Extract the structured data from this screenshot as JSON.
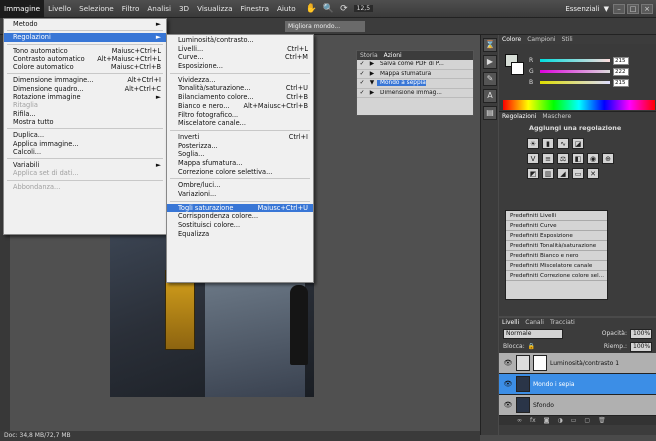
{
  "menubar": {
    "items": [
      "Immagine",
      "Livello",
      "Selezione",
      "Filtro",
      "Analisi",
      "3D",
      "Visualizza",
      "Finestra",
      "Aiuto"
    ],
    "active": 0,
    "workspace": "Essenziali",
    "zoom_label": "12,5",
    "tab_label": "Migliora mondo..."
  },
  "main_menu": {
    "items": [
      {
        "label": "Metodo",
        "shortcut": "►"
      },
      {
        "sep": true
      },
      {
        "label": "Regolazioni",
        "shortcut": "►",
        "hl": true
      },
      {
        "sep": true
      },
      {
        "label": "Tono automatico",
        "shortcut": "Maiusc+Ctrl+L"
      },
      {
        "label": "Contrasto automatico",
        "shortcut": "Alt+Maiusc+Ctrl+L"
      },
      {
        "label": "Colore automatico",
        "shortcut": "Maiusc+Ctrl+B"
      },
      {
        "sep": true
      },
      {
        "label": "Dimensione immagine...",
        "shortcut": "Alt+Ctrl+I"
      },
      {
        "label": "Dimensione quadro...",
        "shortcut": "Alt+Ctrl+C"
      },
      {
        "label": "Rotazione immagine",
        "shortcut": "►"
      },
      {
        "label": "Ritaglia",
        "shortcut": "",
        "dis": true
      },
      {
        "label": "Rifila...",
        "shortcut": ""
      },
      {
        "label": "Mostra tutto",
        "shortcut": ""
      },
      {
        "sep": true
      },
      {
        "label": "Duplica...",
        "shortcut": ""
      },
      {
        "label": "Applica immagine...",
        "shortcut": ""
      },
      {
        "label": "Calcoli...",
        "shortcut": ""
      },
      {
        "sep": true
      },
      {
        "label": "Variabili",
        "shortcut": "►"
      },
      {
        "label": "Applica set di dati...",
        "shortcut": "",
        "dis": true
      },
      {
        "sep": true
      },
      {
        "label": "Abbondanza...",
        "shortcut": "",
        "dis": true
      }
    ]
  },
  "sub_menu": {
    "items": [
      {
        "label": "Luminosità/contrasto...",
        "shortcut": ""
      },
      {
        "label": "Livelli...",
        "shortcut": "Ctrl+L"
      },
      {
        "label": "Curve...",
        "shortcut": "Ctrl+M"
      },
      {
        "label": "Esposizione...",
        "shortcut": ""
      },
      {
        "sep": true
      },
      {
        "label": "Vividezza...",
        "shortcut": ""
      },
      {
        "label": "Tonalità/saturazione...",
        "shortcut": "Ctrl+U"
      },
      {
        "label": "Bilanciamento colore...",
        "shortcut": "Ctrl+B"
      },
      {
        "label": "Bianco e nero...",
        "shortcut": "Alt+Maiusc+Ctrl+B"
      },
      {
        "label": "Filtro fotografico...",
        "shortcut": ""
      },
      {
        "label": "Miscelatore canale...",
        "shortcut": ""
      },
      {
        "sep": true
      },
      {
        "label": "Inverti",
        "shortcut": "Ctrl+I"
      },
      {
        "label": "Posterizza...",
        "shortcut": ""
      },
      {
        "label": "Soglia...",
        "shortcut": ""
      },
      {
        "label": "Mappa sfumatura...",
        "shortcut": ""
      },
      {
        "label": "Correzione colore selettiva...",
        "shortcut": ""
      },
      {
        "sep": true
      },
      {
        "label": "Ombre/luci...",
        "shortcut": ""
      },
      {
        "label": "Variazioni...",
        "shortcut": ""
      },
      {
        "sep": true
      },
      {
        "label": "Togli saturazione",
        "shortcut": "Maiusc+Ctrl+U",
        "hl": true
      },
      {
        "label": "Corrispondenza colore...",
        "shortcut": ""
      },
      {
        "label": "Sostituisci colore...",
        "shortcut": ""
      },
      {
        "label": "Equalizza",
        "shortcut": ""
      }
    ]
  },
  "actions_panel": {
    "tabs": [
      "Storia",
      "Azioni"
    ],
    "rows": [
      {
        "label": "Salva come PDF di P...",
        "hl": false
      },
      {
        "label": "Mappa sfumatura",
        "hl": false
      },
      {
        "label": "Mondo a seppia",
        "hl": true
      },
      {
        "label": "Dimensione immag...",
        "hl": false
      }
    ]
  },
  "color_panel": {
    "tabs": [
      "Colore",
      "Campioni",
      "Stili"
    ],
    "channels": [
      {
        "name": "R",
        "value": "215"
      },
      {
        "name": "G",
        "value": "222"
      },
      {
        "name": "B",
        "value": "215"
      }
    ]
  },
  "adjust_panel": {
    "tabs": [
      "Regolazioni",
      "Maschere"
    ],
    "title": "Aggiungi una regolazione",
    "presets": [
      "Predefiniti Livelli",
      "Predefiniti Curve",
      "Predefiniti Esposizione",
      "Predefiniti Tonalità/saturazione",
      "Predefiniti Bianco e nero",
      "Predefiniti Miscelatore canale",
      "Predefiniti Correzione colore sel..."
    ]
  },
  "layers_panel": {
    "tabs": [
      "Livelli",
      "Canali",
      "Tracciati"
    ],
    "blend_mode": "Normale",
    "opacity_label": "Opacità:",
    "opacity": "100%",
    "lock_label": "Blocca:",
    "fill_label": "Riemp.:",
    "fill": "100%",
    "layers": [
      {
        "name": "Luminosità/contrasto 1",
        "sel": false
      },
      {
        "name": "Mondo i sepia",
        "sel": true
      },
      {
        "name": "Sfondo",
        "sel": false
      }
    ]
  },
  "status": "Doc: 34,8 MB/72,7 MB",
  "colors": {
    "highlight": "#3876d6",
    "layer_selected": "#3c8ee6"
  }
}
